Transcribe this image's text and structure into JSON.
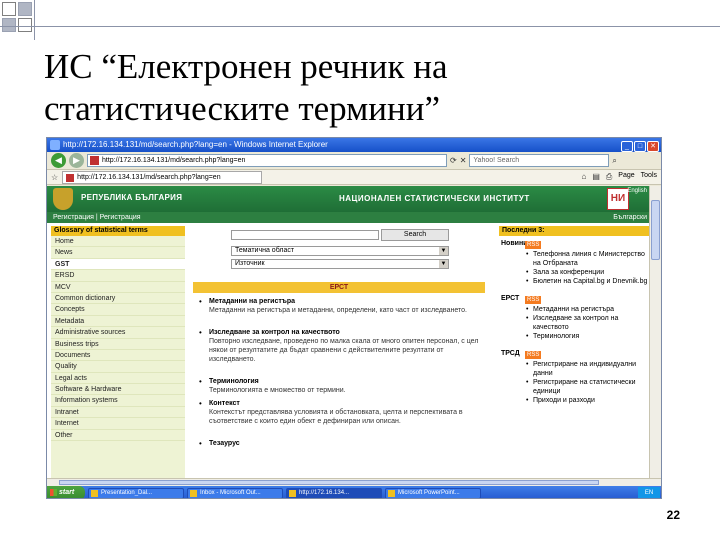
{
  "slide": {
    "title_line1": "ИС “Електронен речник на",
    "title_line2": "статистическите термини”",
    "page_number": "22"
  },
  "browser": {
    "window_title": "http://172.16.134.131/md/search.php?lang=en - Windows Internet Explorer",
    "address": "http://172.16.134.131/md/search.php?lang=en",
    "tab_label": "http://172.16.134.131/md/search.php?lang=en",
    "search_placeholder": "Yahoo! Search",
    "tools": {
      "page": "Page",
      "tools": "Tools"
    }
  },
  "site": {
    "republic": "РЕПУБЛИКА БЪЛГАРИЯ",
    "institute": "НАЦИОНАЛЕН СТАТИСТИЧЕСКИ ИНСТИТУТ",
    "logo_text": "НИ",
    "lang": "English",
    "nav_left": "Регистрация | Регистрация",
    "nav_right": "Български"
  },
  "left_menu": {
    "header": "Glossary of statistical terms",
    "items": [
      "Home",
      "News",
      "GST",
      "ERSD",
      "MCV",
      "Common dictionary",
      "Concepts",
      "Metadata",
      "Administrative sources",
      "Business trips",
      "Documents",
      "Quality",
      "Legal acts",
      "Software & Hardware",
      "Information systems",
      "Intranet",
      "Internet",
      "Other"
    ]
  },
  "search": {
    "button": "Search",
    "select1": "Тематична област",
    "select2": "Източник",
    "section": "ЕРСТ"
  },
  "entries": [
    {
      "title": "Метаданни на регистъра",
      "desc": "Метаданни на регистъра и метаданни, определени, като част от изследването."
    },
    {
      "title": "Изследване за контрол на качеството",
      "desc": "Повторно изследване, проведено по малка скала от много опитен персонал, с цел някои от резултатите да бъдат сравнени с действителните резултати от изследването."
    },
    {
      "title": "Терминология",
      "desc": "Терминологията е множество от термини."
    },
    {
      "title": "Контекст",
      "desc": "Контекстът представлява условията и обстановката, целта и перспективата в съответствие с които един обект е дефиниран или описан."
    },
    {
      "title": "Тезаурус",
      "desc": ""
    }
  ],
  "right_panel": {
    "header": "Последни 3:",
    "groups": [
      {
        "label": "Новини",
        "rss": "RSS",
        "items": [
          "Телефонна линия с Министерство на Отбраната",
          "Зала за конференции",
          "Бюлетин на Capital.bg и Dnevnik.bg"
        ]
      },
      {
        "label": "ЕРСТ",
        "rss": "RSS",
        "items": [
          "Метаданни на регистъра",
          "Изследване за контрол на качеството",
          "Терминология"
        ]
      },
      {
        "label": "ТРСД",
        "rss": "RSS",
        "items": [
          "Регистриране на индивидуални данни",
          "Регистриране на статистически единици",
          "Приходи и разходи"
        ]
      }
    ]
  },
  "taskbar": {
    "start": "start",
    "items": [
      "Presentation_Dal...",
      "Inbox - Microsoft Out...",
      "http://172.16.134...",
      "Microsoft PowerPoint..."
    ],
    "tray": "EN"
  },
  "colors": {
    "site_green": "#2b8b45",
    "accent_yellow": "#f0c020",
    "ie_blue": "#2458cf"
  }
}
